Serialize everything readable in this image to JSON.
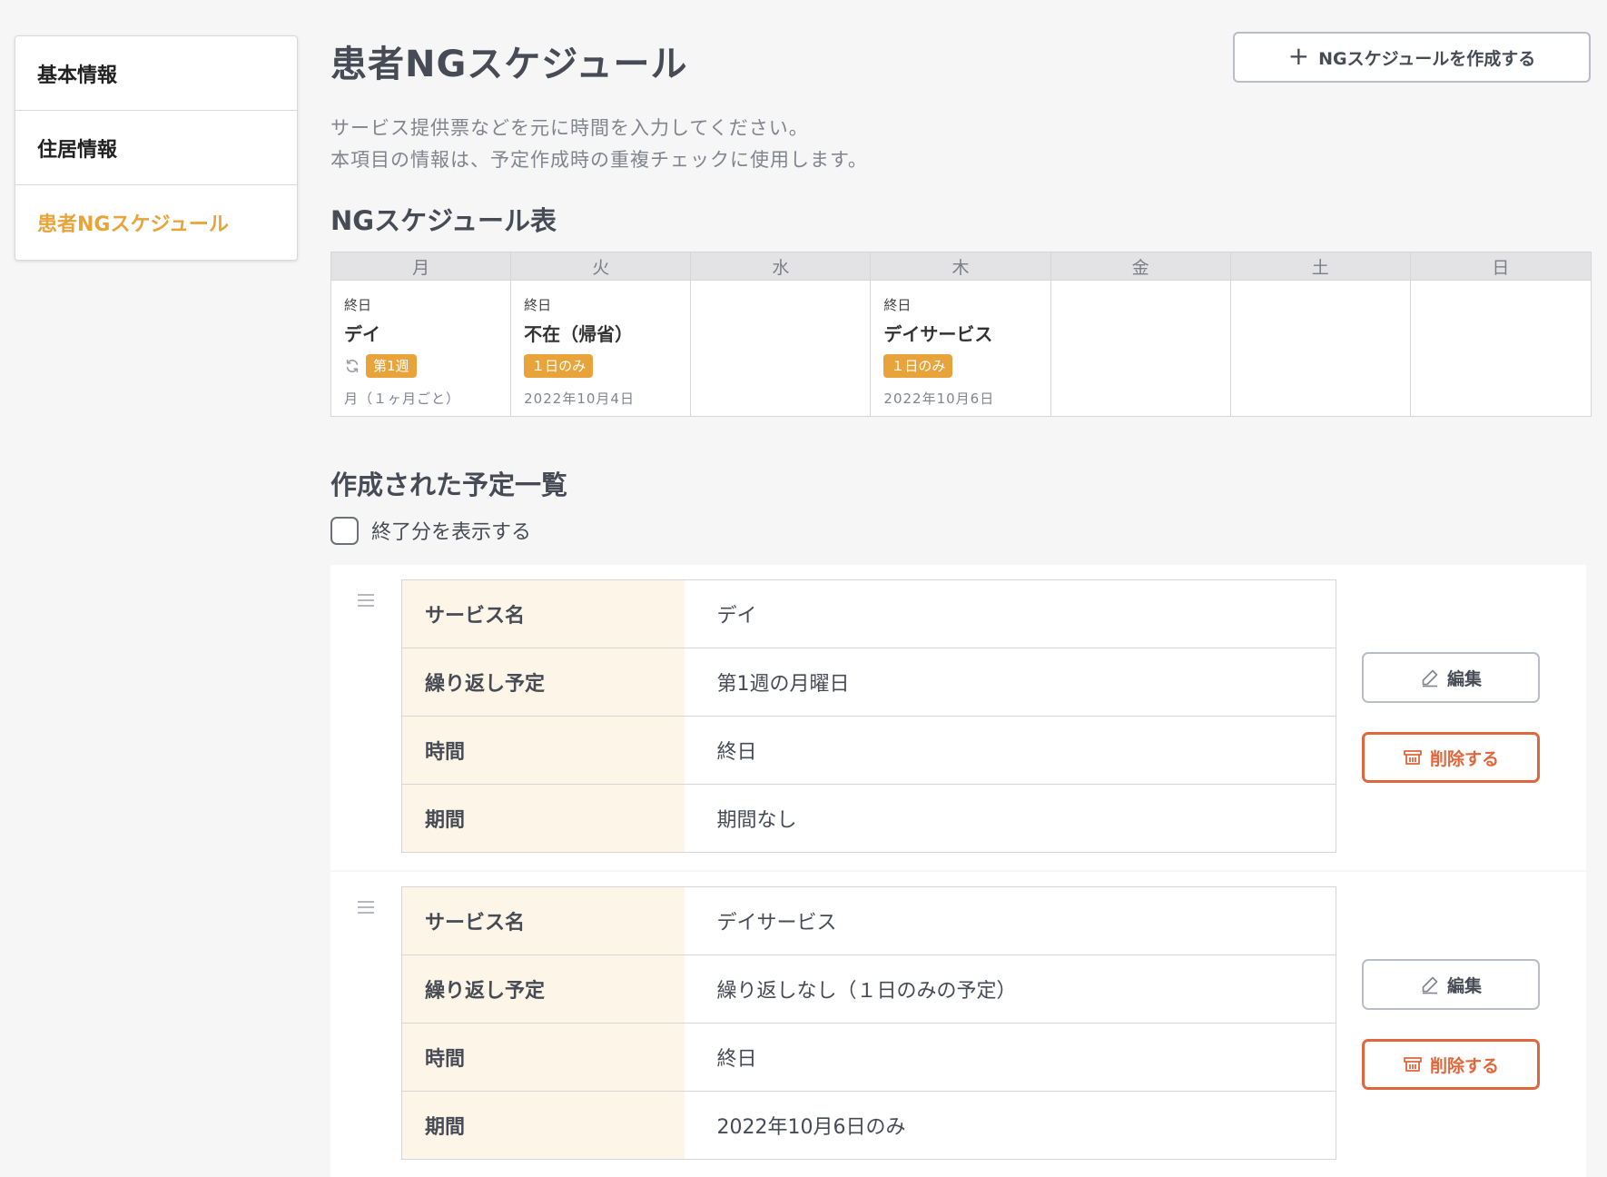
{
  "sidebar": {
    "items": [
      {
        "label": "基本情報"
      },
      {
        "label": "住居情報"
      },
      {
        "label": "患者NGスケジュール"
      }
    ]
  },
  "header": {
    "title": "患者NGスケジュール",
    "create_button": "NGスケジュールを作成する"
  },
  "description": {
    "line1": "サービス提供票などを元に時間を入力してください。",
    "line2": "本項目の情報は、予定作成時の重複チェックに使用します。"
  },
  "week_section": {
    "title": "NGスケジュール表",
    "days": [
      "月",
      "火",
      "水",
      "木",
      "金",
      "土",
      "日"
    ],
    "events": {
      "mon": {
        "time": "終日",
        "name": "デイ",
        "tag": "第1週",
        "note": "月（１ヶ月ごと）",
        "icon": "repeat-icon"
      },
      "tue": {
        "time": "終日",
        "name": "不在（帰省）",
        "tag": "１日のみ",
        "note": "2022年10月4日"
      },
      "thu": {
        "time": "終日",
        "name": "デイサービス",
        "tag": "１日のみ",
        "note": "2022年10月6日"
      }
    }
  },
  "list_section": {
    "title": "作成された予定一覧",
    "show_finished_label": "終了分を表示する",
    "show_finished_checked": false,
    "field_labels": {
      "service": "サービス名",
      "repeat": "繰り返し予定",
      "time": "時間",
      "period": "期間"
    },
    "edit_label": "編集",
    "delete_label": "削除する",
    "cards": [
      {
        "service": "デイ",
        "repeat": "第1週の月曜日",
        "time": "終日",
        "period": "期間なし"
      },
      {
        "service": "デイサービス",
        "repeat": "繰り返しなし（１日のみの予定）",
        "time": "終日",
        "period": "2022年10月6日のみ"
      }
    ]
  },
  "colors": {
    "accent": "#e8a43a",
    "danger": "#e0663c",
    "label_bg": "#fdf6e8"
  }
}
